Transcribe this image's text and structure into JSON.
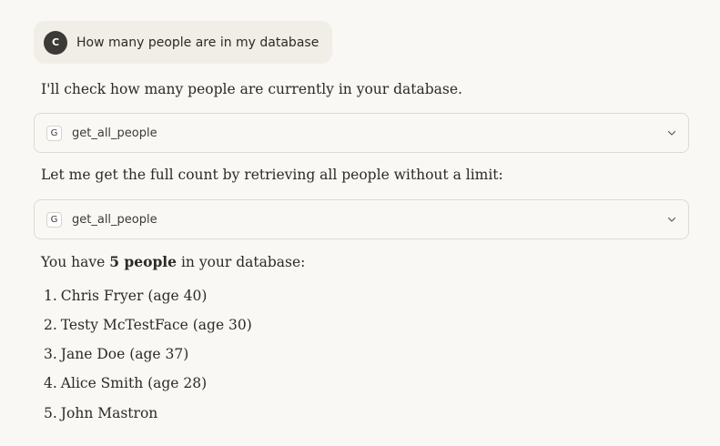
{
  "user_message": {
    "avatar_letter": "C",
    "text": "How many people are in my database"
  },
  "assistant": {
    "intro": "I'll check how many people are currently in your database.",
    "tool_call_1": {
      "badge": "G",
      "name": "get_all_people"
    },
    "followup": "Let me get the full count by retrieving all people without a limit:",
    "tool_call_2": {
      "badge": "G",
      "name": "get_all_people"
    },
    "summary": {
      "prefix": "You have ",
      "bold": "5 people",
      "suffix": " in your database:"
    },
    "people": [
      {
        "num": "1.",
        "text": "Chris Fryer (age 40)"
      },
      {
        "num": "2.",
        "text": "Testy McTestFace (age 30)"
      },
      {
        "num": "3.",
        "text": "Jane Doe (age 37)"
      },
      {
        "num": "4.",
        "text": "Alice Smith (age 28)"
      },
      {
        "num": "5.",
        "text": "John Mastron"
      }
    ]
  }
}
